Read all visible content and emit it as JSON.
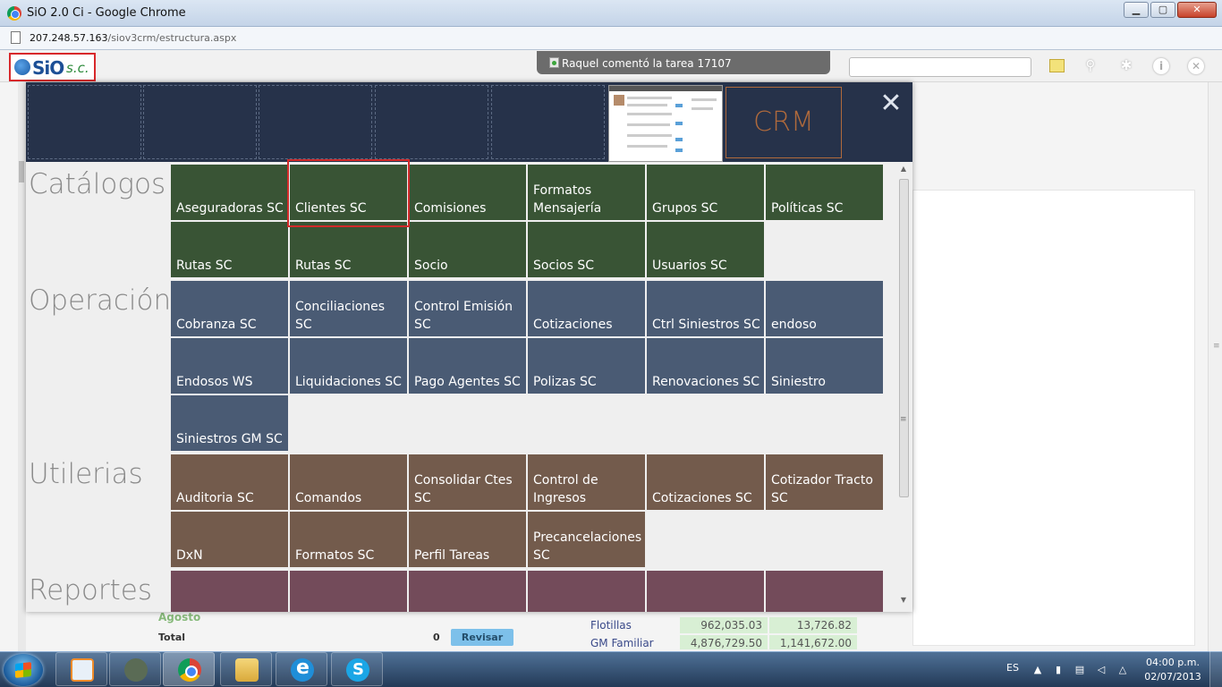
{
  "window": {
    "title": "SiO 2.0 Ci - Google Chrome",
    "url_host": "207.248.57.163",
    "url_path": "/siov3crm/estructura.aspx",
    "buttons": {
      "minimize": "▁",
      "maximize": "▢",
      "close": "✕"
    }
  },
  "app": {
    "logo_brand": "SiO",
    "logo_suffix": "s.c.",
    "notification": "Raquel comentó la tarea 17107",
    "search_placeholder": "",
    "icons": [
      "sticky-note-icon",
      "search-icon",
      "gear-icon",
      "info-icon",
      "close-icon"
    ],
    "icon_glyphs": {
      "zoom": "⚲",
      "gear": "✱",
      "info": "i",
      "close": "✕"
    }
  },
  "panel": {
    "crm_label": "CRM",
    "close_glyph": "✕",
    "sections": {
      "catalogos": {
        "title": "Catálogos",
        "tiles": [
          "Aseguradoras SC",
          "Clientes SC",
          "Comisiones",
          "Formatos Mensajería",
          "Grupos SC",
          "Políticas SC",
          "Rutas SC",
          "Rutas SC",
          "Socio",
          "Socios SC",
          "Usuarios SC"
        ]
      },
      "operacion": {
        "title": "Operación",
        "tiles": [
          "Cobranza SC",
          "Conciliaciones SC",
          "Control Emisión SC",
          "Cotizaciones",
          "Ctrl Siniestros SC",
          "endoso",
          "Endosos WS",
          "Liquidaciones SC",
          "Pago Agentes SC",
          "Polizas SC",
          "Renovaciones SC",
          "Siniestro",
          "Siniestros GM SC"
        ]
      },
      "utilerias": {
        "title": "Utilerias",
        "tiles": [
          "Auditoria SC",
          "Comandos",
          "Consolidar Ctes SC",
          "Control de Ingresos",
          "Cotizaciones SC",
          "Cotizador Tracto SC",
          "DxN",
          "Formatos SC",
          "Perfil Tareas",
          "Precancelaciones SC"
        ]
      },
      "reportes": {
        "title": "Reportes",
        "tiles": [
          "",
          "",
          "",
          "",
          "",
          ""
        ]
      }
    },
    "colors": {
      "catalogos": "#395435",
      "operacion": "#4a5b74",
      "utilerias": "#735b4c",
      "reportes": "#734b5a"
    }
  },
  "background": {
    "month": "Agosto",
    "total_label": "Total",
    "total_value": "0",
    "revisar_label": "Revisar",
    "stats": [
      {
        "label": "Flotillas",
        "v1": "962,035.03",
        "v2": "13,726.82"
      },
      {
        "label": "GM Familiar",
        "v1": "4,876,729.50",
        "v2": "1,141,672.00"
      }
    ]
  },
  "taskbar": {
    "apps": [
      "media-player",
      "evernote",
      "chrome",
      "file-explorer",
      "internet-explorer",
      "skype"
    ],
    "language": "ES",
    "time": "04:00 p.m.",
    "date": "02/07/2013"
  }
}
